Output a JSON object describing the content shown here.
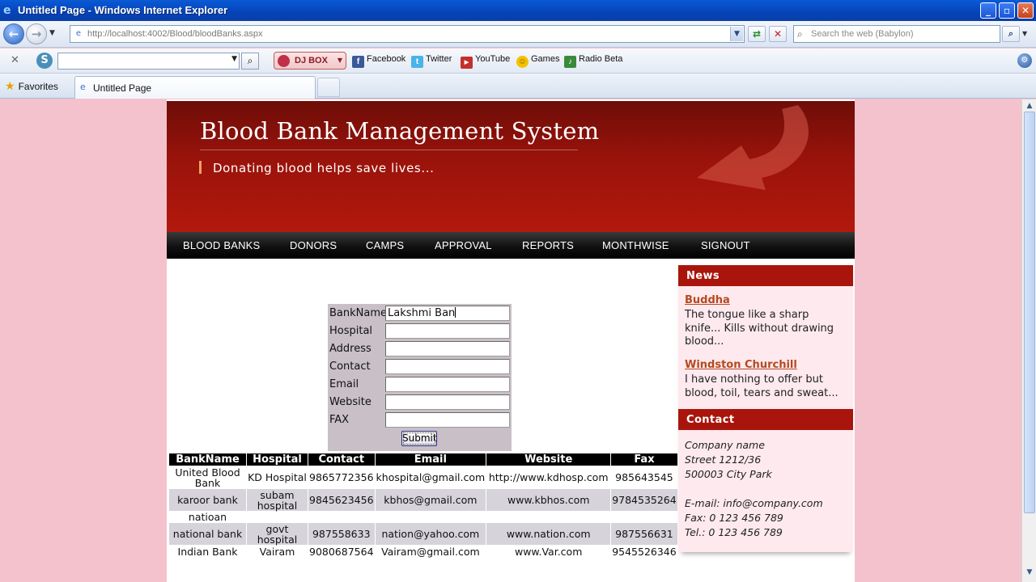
{
  "window": {
    "title": "Untitled Page - Windows Internet Explorer"
  },
  "address_bar": {
    "url": "http://localhost:4002/Blood/bloodBanks.aspx",
    "search_placeholder": "Search the web (Babylon)"
  },
  "toolbar": {
    "djbox_label": "DJ BOX",
    "links": [
      "Facebook",
      "Twitter",
      "YouTube",
      "Games",
      "Radio Beta"
    ]
  },
  "tabs": {
    "favorites_label": "Favorites",
    "active_tab": "Untitled Page"
  },
  "site": {
    "title": "Blood Bank Management System",
    "tagline": "Donating blood helps save lives..."
  },
  "menu": [
    "BLOOD BANKS",
    "DONORS",
    "CAMPS",
    "APPROVAL",
    "REPORTS",
    "MONTHWISE",
    "SIGNOUT"
  ],
  "form": {
    "fields": [
      {
        "label": "BankName",
        "value": "Lakshmi Ban"
      },
      {
        "label": "Hospital",
        "value": ""
      },
      {
        "label": "Address",
        "value": ""
      },
      {
        "label": "Contact",
        "value": ""
      },
      {
        "label": "Email",
        "value": ""
      },
      {
        "label": "Website",
        "value": ""
      },
      {
        "label": "FAX",
        "value": ""
      }
    ],
    "submit_label": "Submit"
  },
  "table": {
    "headers": [
      "BankName",
      "Hospital",
      "Contact",
      "Email",
      "Website",
      "Fax"
    ],
    "rows": [
      [
        "United Blood Bank",
        "KD Hospital",
        "9865772356",
        "khospital@gmail.com",
        "http://www.kdhosp.com",
        "985643545"
      ],
      [
        "karoor bank",
        "subam hospital",
        "9845623456",
        "kbhos@gmail.com",
        "www.kbhos.com",
        "9784535264"
      ],
      [
        "natioan",
        "",
        "",
        "",
        "",
        ""
      ],
      [
        "national bank",
        "govt hospital",
        "987558633",
        "nation@yahoo.com",
        "www.nation.com",
        "987556631"
      ],
      [
        "Indian Bank",
        "Vairam",
        "9080687564",
        "Vairam@gmail.com",
        "www.Var.com",
        "9545526346"
      ]
    ]
  },
  "sidebar": {
    "news_title": "News",
    "news": [
      {
        "heading": "Buddha",
        "text": "The tongue like a sharp knife... Kills without drawing blood..."
      },
      {
        "heading": "Windston Churchill",
        "text": "I have nothing to offer but blood, toil, tears and sweat..."
      }
    ],
    "contact_title": "Contact",
    "contact_lines": [
      "Company name",
      "Street 1212/36",
      "500003 City Park",
      "",
      "E-mail: info@company.com",
      "Fax: 0 123 456 789",
      "Tel.: 0 123 456 789"
    ]
  },
  "colors": {
    "page_background": "#f4c2cc",
    "header_red": "#a9150c",
    "menu_black": "#000000",
    "news_link": "#b5491e"
  }
}
